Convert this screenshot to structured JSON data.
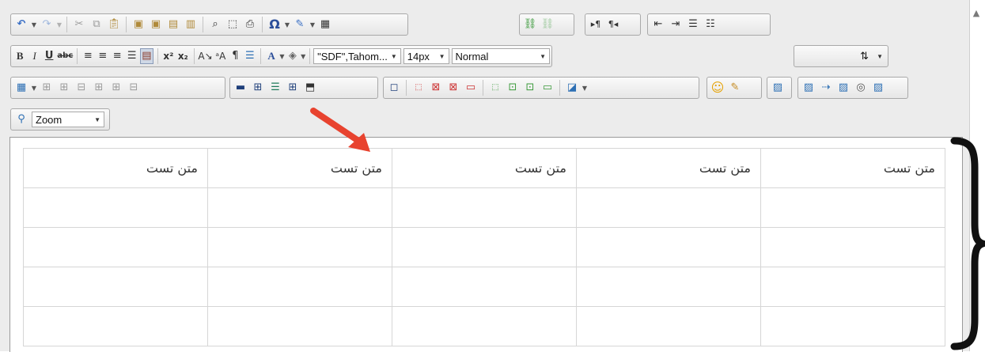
{
  "toolbar": {
    "font_value": "\"SDF\",Tahom...",
    "size_value": "14px",
    "format_value": "Normal",
    "zoom_label": "Zoom",
    "color_text_label": "A",
    "super_label": "x²",
    "sub_label": "x₂",
    "bold": "B",
    "italic": "I",
    "underline": "U",
    "strike": "abc",
    "omega": "Ω"
  },
  "table": {
    "rows": [
      [
        "متن تست",
        "متن تست",
        "متن تست",
        "متن تست",
        "متن تست"
      ],
      [
        "",
        "",
        "",
        "",
        ""
      ],
      [
        "",
        "",
        "",
        "",
        ""
      ],
      [
        "",
        "",
        "",
        "",
        ""
      ],
      [
        "",
        "",
        "",
        "",
        ""
      ]
    ]
  },
  "colors": {
    "annotation_arrow": "#e8432f",
    "active_button": "#cfd8e6"
  }
}
